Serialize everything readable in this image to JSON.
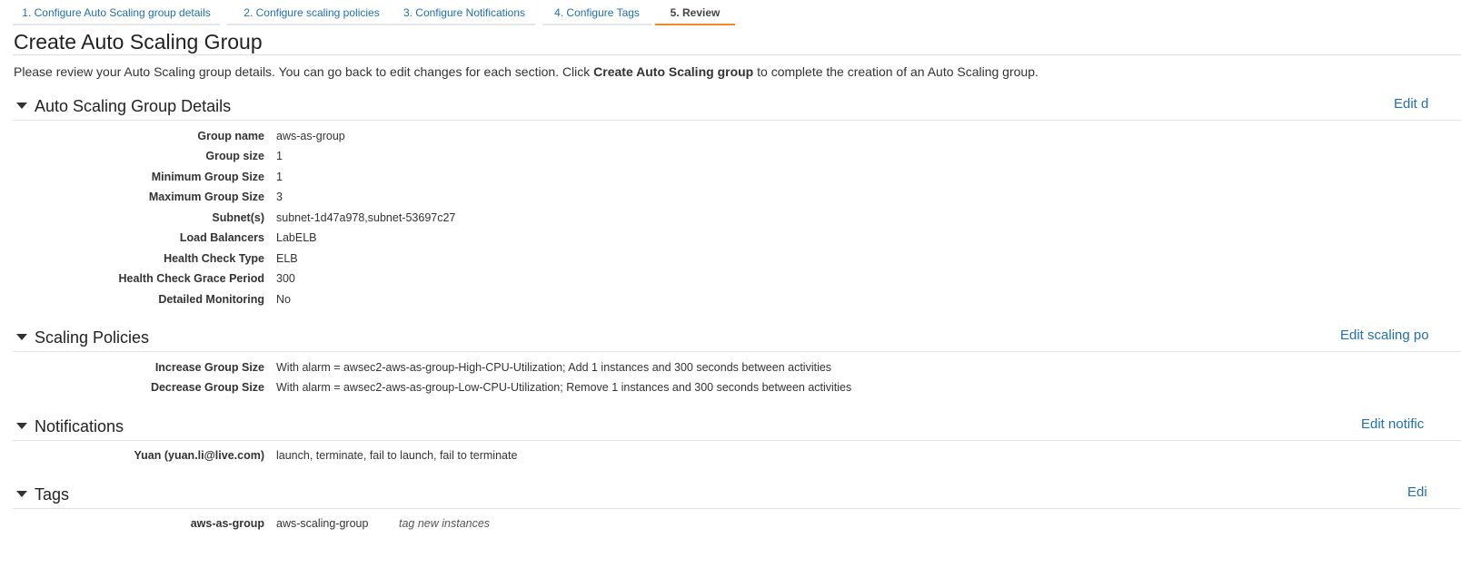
{
  "wizard": {
    "steps": [
      {
        "label": "1. Configure Auto Scaling group details"
      },
      {
        "label": "2. Configure scaling policies"
      },
      {
        "label": "3. Configure Notifications"
      },
      {
        "label": "4. Configure Tags"
      },
      {
        "label": "5. Review",
        "active": true
      }
    ]
  },
  "page": {
    "title": "Create Auto Scaling Group",
    "intro_before": "Please review your Auto Scaling group details. You can go back to edit changes for each section. Click ",
    "intro_bold": "Create Auto Scaling group",
    "intro_after": " to complete the creation of an Auto Scaling group."
  },
  "sections": {
    "details": {
      "title": "Auto Scaling Group Details",
      "edit": "Edit d",
      "rows": [
        {
          "label": "Group name",
          "value": "aws-as-group"
        },
        {
          "label": "Group size",
          "value": "1"
        },
        {
          "label": "Minimum Group Size",
          "value": "1"
        },
        {
          "label": "Maximum Group Size",
          "value": "3"
        },
        {
          "label": "Subnet(s)",
          "value": "subnet-1d47a978,subnet-53697c27"
        },
        {
          "label": "Load Balancers",
          "value": "LabELB"
        },
        {
          "label": "Health Check Type",
          "value": "ELB"
        },
        {
          "label": "Health Check Grace Period",
          "value": "300"
        },
        {
          "label": "Detailed Monitoring",
          "value": "No"
        }
      ]
    },
    "policies": {
      "title": "Scaling Policies",
      "edit": "Edit scaling po",
      "rows": [
        {
          "label": "Increase Group Size",
          "value": "With alarm = awsec2-aws-as-group-High-CPU-Utilization; Add 1 instances and 300 seconds between activities"
        },
        {
          "label": "Decrease Group Size",
          "value": "With alarm = awsec2-aws-as-group-Low-CPU-Utilization; Remove 1 instances and 300 seconds between activities"
        }
      ]
    },
    "notifications": {
      "title": "Notifications",
      "edit": "Edit notific",
      "rows": [
        {
          "label": "Yuan (yuan.li@live.com)",
          "value": "launch, terminate, fail to launch, fail to terminate"
        }
      ]
    },
    "tags": {
      "title": "Tags",
      "edit": "Edi",
      "rows": [
        {
          "label": "aws-as-group",
          "value": "aws-scaling-group",
          "extra": "tag new instances"
        }
      ]
    }
  },
  "colors": {
    "link": "#1f6fb2",
    "active_tab_underline": "#f08a24"
  }
}
